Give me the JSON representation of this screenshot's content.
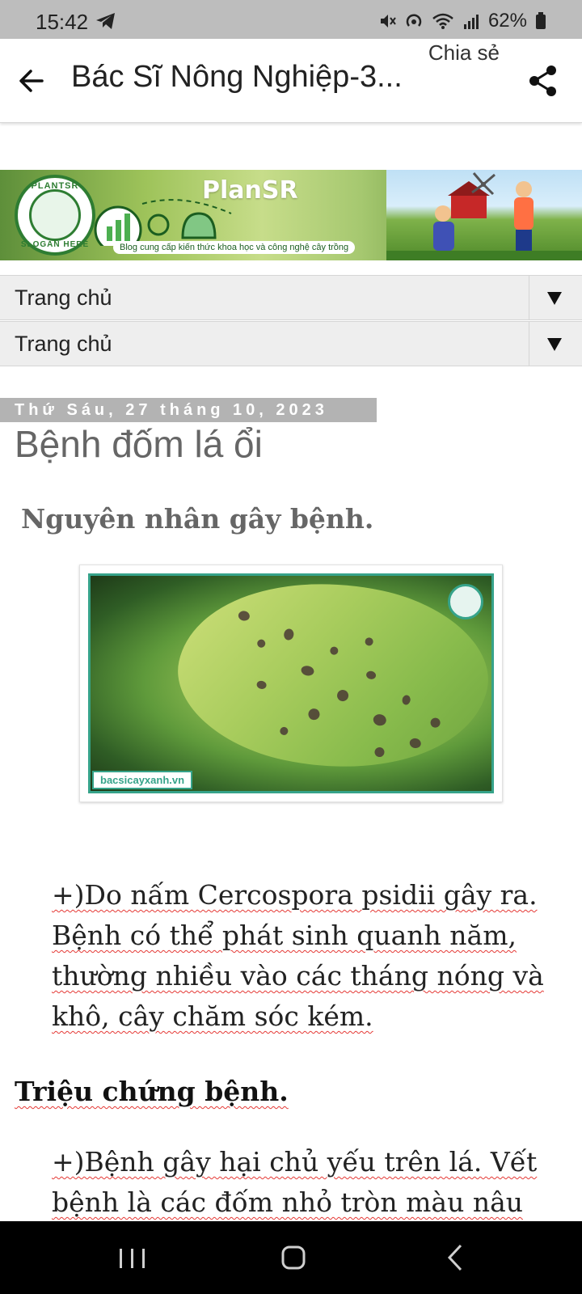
{
  "status_bar": {
    "time": "15:42",
    "battery": "62%",
    "icons": [
      "telegram-icon",
      "mute-icon",
      "hotspot-icon",
      "wifi-icon",
      "signal-icon",
      "battery-icon"
    ]
  },
  "app_bar": {
    "title": "Bác Sĩ Nông Nghiệp-3...",
    "share_label": "Chia sẻ",
    "back_icon": "arrow-left-icon",
    "share_icon": "share-icon"
  },
  "banner": {
    "logo_top": "PLANTSR",
    "logo_bottom": "SLOGAN HERE",
    "brand": "PlanSR",
    "caption": "Blog cung cấp kiến thức khoa học và công nghệ cây trồng"
  },
  "nav": {
    "items": [
      {
        "label": "Trang chủ"
      },
      {
        "label": "Trang chủ"
      }
    ]
  },
  "post": {
    "date": "Thứ Sáu, 27 tháng 10, 2023",
    "title": "Bệnh đốm lá ổi",
    "cause_heading": "Nguyên nhân gây bệnh.",
    "image_watermark": "bacsicayxanh.vn",
    "paragraph_1": "+)Do nấm Cercospora psidii gây ra. Bệnh có thể phát sinh quanh năm, thường nhiều vào các tháng nóng và khô, cây chăm sóc kém.",
    "symptom_heading": "Triệu chứng bệnh.",
    "paragraph_2": "+)Bệnh gây hại chủ yếu trên lá. Vết bệnh là các đốm nhỏ tròn màu nâu"
  },
  "system_nav": {
    "icons": [
      "recents-icon",
      "home-icon",
      "back-icon"
    ]
  },
  "colors": {
    "status_bar_bg": "#bdbdbd",
    "date_badge_bg": "#b3b3b3",
    "title_gray": "#666666",
    "image_border": "#36a38a",
    "spellcheck_underline": "#e53935"
  }
}
